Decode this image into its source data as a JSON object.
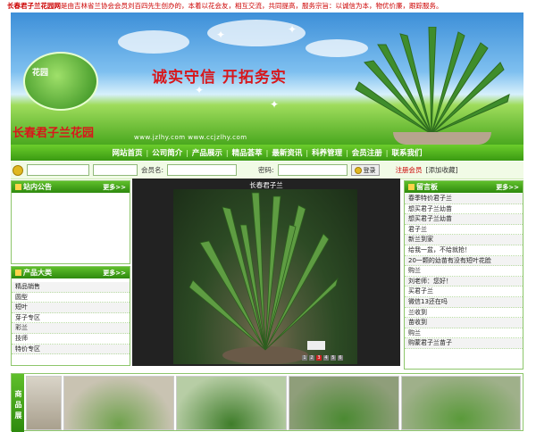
{
  "topline": {
    "site": "长春君子兰花园网",
    "text": "是由吉林省兰协会会员刘百四先生创办的，本着以花会友，相互交流，共同提高，服务宗旨：以诚信为本，物优价廉，跟踪服务。"
  },
  "banner": {
    "logo_text": "花园",
    "slogan": "诚实守信    开拓务实",
    "sitename": "长春君子兰花园",
    "urls": "www.jzlhy.com   www.ccjzlhy.com"
  },
  "nav": {
    "items": [
      "网站首页",
      "公司简介",
      "产品展示",
      "精品荟萃",
      "最新资讯",
      "科养管理",
      "会员注册",
      "联系我们"
    ]
  },
  "login": {
    "member_label": "会员名:",
    "password_label": "密码:",
    "login_button": "登录",
    "register": "注册会员",
    "favorite": "[添加收藏]"
  },
  "notice": {
    "title": "站内公告",
    "more": "更多>>"
  },
  "categories": {
    "title": "产品大类",
    "more": "更多>>",
    "items": [
      "精品销售",
      "圆型",
      "短叶",
      "芽子专区",
      "彩兰",
      "技师",
      "特价专区"
    ]
  },
  "slideshow": {
    "caption": "长春君子兰",
    "pages": [
      "1",
      "2",
      "3",
      "4",
      "5",
      "6"
    ],
    "active_page": 3
  },
  "guestbook": {
    "title": "留言板",
    "more": "更多>>",
    "items": [
      "春季特价君子兰",
      "想买君子兰幼苗",
      "想买君子兰幼苗",
      "君子兰",
      "新兰到家",
      "给我一盆，不给就抢！",
      "20一颗的幼苗有没有短叶花脸",
      "购兰",
      "刘老师：您好！",
      "买君子兰",
      "微信13还在吗",
      "兰收到",
      "苗收到",
      "购兰",
      "购蒙君子兰苗子"
    ]
  },
  "showcase": {
    "label": "商品展"
  }
}
